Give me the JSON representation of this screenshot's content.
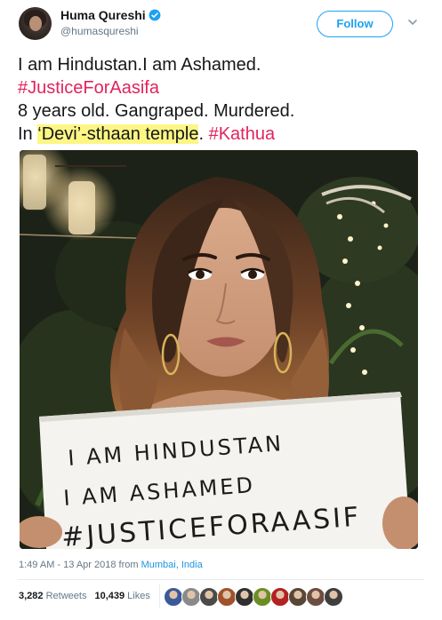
{
  "author": {
    "name": "Huma Qureshi",
    "handle": "@humasqureshi",
    "verified": true,
    "avatar_icon": "profile-avatar"
  },
  "follow_label": "Follow",
  "tweet": {
    "line1": "I am Hindustan.I am Ashamed.",
    "line2_hashtag": "#JusticeForAasifa",
    "line3": "8 years old. Gangraped. Murdered.",
    "line4_prefix": "In ",
    "line4_highlight": "‘Devi’-sthaan temple",
    "line4_dot": ". ",
    "line4_hashtag": "#Kathua"
  },
  "photo": {
    "sign_lines": [
      "I AM HINDUSTAN",
      "I AM ASHAMED",
      "#JUSTICEFORAASIF"
    ]
  },
  "meta": {
    "time": "1:49 AM - 13 Apr 2018",
    "from_word": "from",
    "location": "Mumbai, India"
  },
  "stats": {
    "retweets_count": "3,282",
    "retweets_label": "Retweets",
    "likes_count": "10,439",
    "likes_label": "Likes"
  },
  "likers": [
    {
      "icon": "liker-avatar",
      "color": "#3b5998"
    },
    {
      "icon": "liker-avatar",
      "color": "#8a8a8a"
    },
    {
      "icon": "liker-avatar",
      "color": "#4a4a4a"
    },
    {
      "icon": "liker-avatar",
      "color": "#a0522d"
    },
    {
      "icon": "liker-avatar",
      "color": "#2f2f2f"
    },
    {
      "icon": "liker-avatar",
      "color": "#6b8e23"
    },
    {
      "icon": "liker-avatar",
      "color": "#b22222"
    },
    {
      "icon": "liker-avatar",
      "color": "#5a4636"
    },
    {
      "icon": "liker-avatar",
      "color": "#6d4c41"
    },
    {
      "icon": "liker-avatar",
      "color": "#3e3e3e"
    }
  ],
  "colors": {
    "link_blue": "#1da1f2",
    "hashtag": "#e0245e",
    "highlight": "#fdf684",
    "secondary_text": "#657786"
  }
}
